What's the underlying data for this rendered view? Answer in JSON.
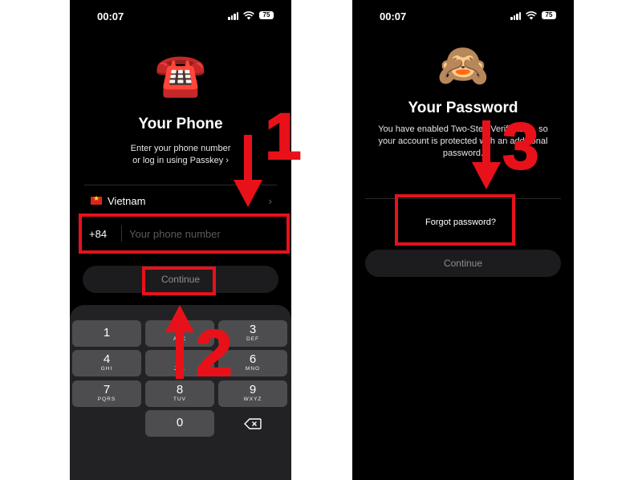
{
  "left_screen": {
    "status": {
      "time": "00:07",
      "battery": "75"
    },
    "emoji": "☎️",
    "title": "Your Phone",
    "subtitle_line1": "Enter your phone number",
    "subtitle_line2": "or log in using Passkey ›",
    "country": "Vietnam",
    "country_code": "+84",
    "phone_placeholder": "Your phone number",
    "continue_label": "Continue",
    "keypad": [
      {
        "digit": "1",
        "letters": ""
      },
      {
        "digit": "2",
        "letters": "ABC"
      },
      {
        "digit": "3",
        "letters": "DEF"
      },
      {
        "digit": "4",
        "letters": "GHI"
      },
      {
        "digit": "5",
        "letters": "JKL"
      },
      {
        "digit": "6",
        "letters": "MNO"
      },
      {
        "digit": "7",
        "letters": "PQRS"
      },
      {
        "digit": "8",
        "letters": "TUV"
      },
      {
        "digit": "9",
        "letters": "WXYZ"
      },
      {
        "digit": "0",
        "letters": ""
      }
    ]
  },
  "right_screen": {
    "status": {
      "time": "00:07",
      "battery": "75"
    },
    "emoji": "🙈",
    "title": "Your Password",
    "subtitle_line1": "You have enabled Two-Step Verification, so",
    "subtitle_line2": "your account is protected with an additional",
    "subtitle_line3": "password.",
    "forgot_label": "Forgot password?",
    "continue_label": "Continue"
  },
  "annotations": {
    "step1": "1",
    "step2": "2",
    "step3": "3",
    "color": "#e8111a"
  }
}
